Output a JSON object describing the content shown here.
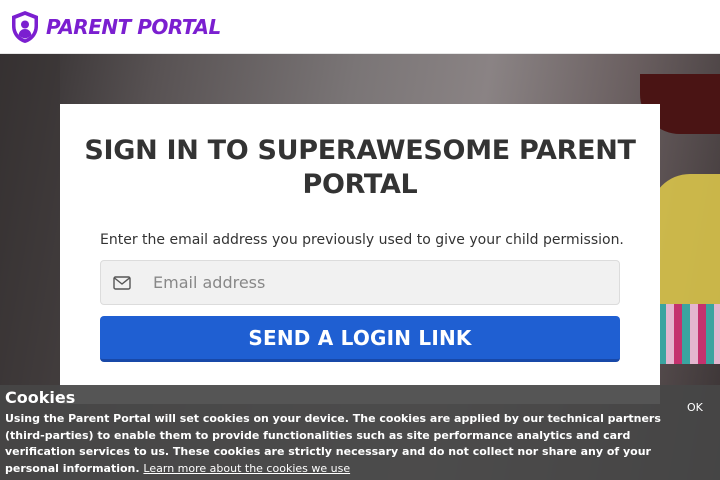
{
  "header": {
    "logo_text": "PARENT PORTAL",
    "logo_icon": "shield-user-icon",
    "brand_color": "#7b1fd0"
  },
  "login_card": {
    "title": "SIGN IN TO SUPERAWESOME PARENT PORTAL",
    "description": "Enter the email address you previously used to give your child permission.",
    "email_icon": "envelope-icon",
    "email_placeholder": "Email address",
    "email_value": "",
    "send_button_label": "SEND A LOGIN LINK",
    "button_color": "#1f5fd2"
  },
  "cookie_banner": {
    "title": "Cookies",
    "text": "Using the Parent Portal will set cookies on your device. The cookies are applied by our technical partners (third-parties) to enable them to provide functionalities such as site performance analytics and card verification services to us. These cookies are strictly necessary and do not collect nor share any of your personal information.",
    "link_text": "Learn more about the cookies we use",
    "ok_label": "OK"
  }
}
